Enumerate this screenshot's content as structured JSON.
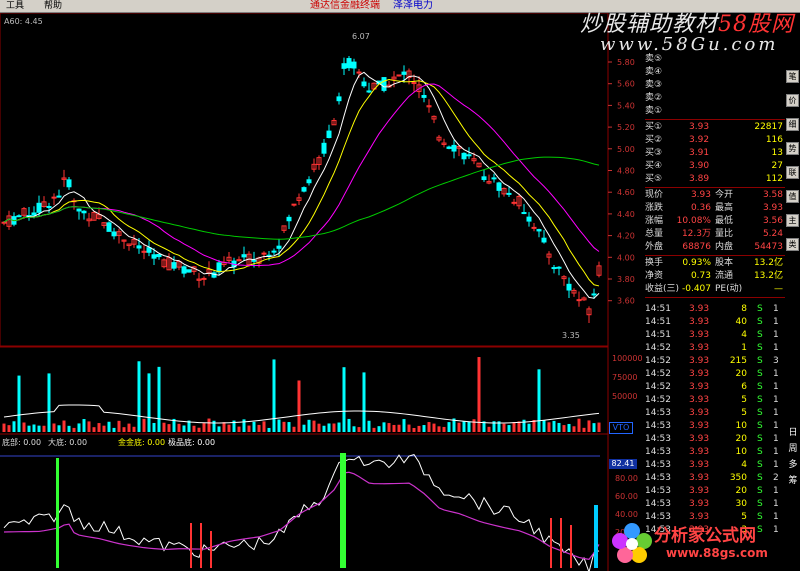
{
  "menu": {
    "items": [
      "工具",
      "帮助"
    ],
    "title": "通达信金融终端",
    "stock_name": "泽泽电力"
  },
  "watermark_top": {
    "line1_a": "炒股辅助教材",
    "line1_b": "58股网",
    "line2": "www.58Gu.com"
  },
  "watermark_bottom": {
    "line1": "分析家公式网",
    "line2": "www.88gs.com"
  },
  "ma_label": "A60: 4.45",
  "price_axis": [
    "5.80",
    "5.60",
    "5.40",
    "5.20",
    "5.00",
    "4.80",
    "4.60",
    "4.40",
    "4.20",
    "4.00",
    "3.80",
    "3.60"
  ],
  "annotations": {
    "high": "6.07",
    "low": "3.35"
  },
  "volume_axis": [
    "100000",
    "75000",
    "50000"
  ],
  "volume_badge": "VTO",
  "indicator": {
    "labels": [
      {
        "text": "底部: 0.00",
        "color": "#dddddd"
      },
      {
        "text": "大底: 0.00",
        "color": "#dddddd"
      },
      {
        "text": "金金底: 0.00",
        "color": "#ffff00"
      },
      {
        "text": "极品底: 0.00",
        "color": "#ffffff"
      }
    ],
    "value_badge": "82.41",
    "axis": [
      "80.00",
      "60.00",
      "40.00",
      "20.00"
    ]
  },
  "quote": {
    "asks": [
      {
        "label": "卖⑤",
        "price": "",
        "vol": ""
      },
      {
        "label": "卖④",
        "price": "",
        "vol": ""
      },
      {
        "label": "卖③",
        "price": "",
        "vol": ""
      },
      {
        "label": "卖②",
        "price": "",
        "vol": ""
      },
      {
        "label": "卖①",
        "price": "",
        "vol": ""
      }
    ],
    "bids": [
      {
        "label": "买①",
        "price": "3.93",
        "vol": "22817"
      },
      {
        "label": "买②",
        "price": "3.92",
        "vol": "116"
      },
      {
        "label": "买③",
        "price": "3.91",
        "vol": "13"
      },
      {
        "label": "买④",
        "price": "3.90",
        "vol": "27"
      },
      {
        "label": "买⑤",
        "price": "3.89",
        "vol": "112"
      }
    ],
    "stats": [
      {
        "k1": "现价",
        "v1": "3.93",
        "k2": "今开",
        "v2": "3.58"
      },
      {
        "k1": "涨跌",
        "v1": "0.36",
        "k2": "最高",
        "v2": "3.93"
      },
      {
        "k1": "涨幅",
        "v1": "10.08%",
        "k2": "最低",
        "v2": "3.56"
      },
      {
        "k1": "总量",
        "v1": "12.3万",
        "k2": "量比",
        "v2": "5.24"
      },
      {
        "k1": "外盘",
        "v1": "68876",
        "k2": "内盘",
        "v2": "54473"
      }
    ],
    "stats2": [
      {
        "k1": "换手",
        "v1": "0.93%",
        "k2": "股本",
        "v2": "13.2亿"
      },
      {
        "k1": "净资",
        "v1": "0.73",
        "k2": "流通",
        "v2": "13.2亿"
      },
      {
        "k1": "收益(三)",
        "v1": "-0.407",
        "k2": "PE(动)",
        "v2": "—"
      }
    ]
  },
  "ticks": [
    {
      "time": "14:51",
      "price": "3.93",
      "vol": "8",
      "side": "S",
      "n": "1"
    },
    {
      "time": "14:51",
      "price": "3.93",
      "vol": "40",
      "side": "S",
      "n": "1"
    },
    {
      "time": "14:51",
      "price": "3.93",
      "vol": "4",
      "side": "S",
      "n": "1"
    },
    {
      "time": "14:52",
      "price": "3.93",
      "vol": "1",
      "side": "S",
      "n": "1"
    },
    {
      "time": "14:52",
      "price": "3.93",
      "vol": "215",
      "side": "S",
      "n": "3"
    },
    {
      "time": "14:52",
      "price": "3.93",
      "vol": "20",
      "side": "S",
      "n": "1"
    },
    {
      "time": "14:52",
      "price": "3.93",
      "vol": "6",
      "side": "S",
      "n": "1"
    },
    {
      "time": "14:52",
      "price": "3.93",
      "vol": "5",
      "side": "S",
      "n": "1"
    },
    {
      "time": "14:53",
      "price": "3.93",
      "vol": "5",
      "side": "S",
      "n": "1"
    },
    {
      "time": "14:53",
      "price": "3.93",
      "vol": "10",
      "side": "S",
      "n": "1"
    },
    {
      "time": "14:53",
      "price": "3.93",
      "vol": "20",
      "side": "S",
      "n": "1"
    },
    {
      "time": "14:53",
      "price": "3.93",
      "vol": "10",
      "side": "S",
      "n": "1"
    },
    {
      "time": "14:53",
      "price": "3.93",
      "vol": "4",
      "side": "S",
      "n": "1"
    },
    {
      "time": "14:53",
      "price": "3.93",
      "vol": "350",
      "side": "S",
      "n": "2"
    },
    {
      "time": "14:53",
      "price": "3.93",
      "vol": "20",
      "side": "S",
      "n": "1"
    },
    {
      "time": "14:53",
      "price": "3.93",
      "vol": "30",
      "side": "S",
      "n": "1"
    },
    {
      "time": "14:53",
      "price": "3.93",
      "vol": "5",
      "side": "S",
      "n": "1"
    },
    {
      "time": "14:53",
      "price": "3.93",
      "vol": "3",
      "side": "S",
      "n": "1"
    }
  ],
  "right_tabs": [
    "笔",
    "价",
    "细",
    "势",
    "联",
    "值",
    "主",
    "类"
  ],
  "right_tabs_cn": [
    "日",
    "周",
    "多",
    "筹"
  ],
  "colors": {
    "up": "#ff3333",
    "down": "#00ffff",
    "ma_fast": "#ffffff",
    "ma_mid": "#ffff00",
    "ma_slow": "#ff00ff",
    "ma_long": "#00cc00"
  }
}
